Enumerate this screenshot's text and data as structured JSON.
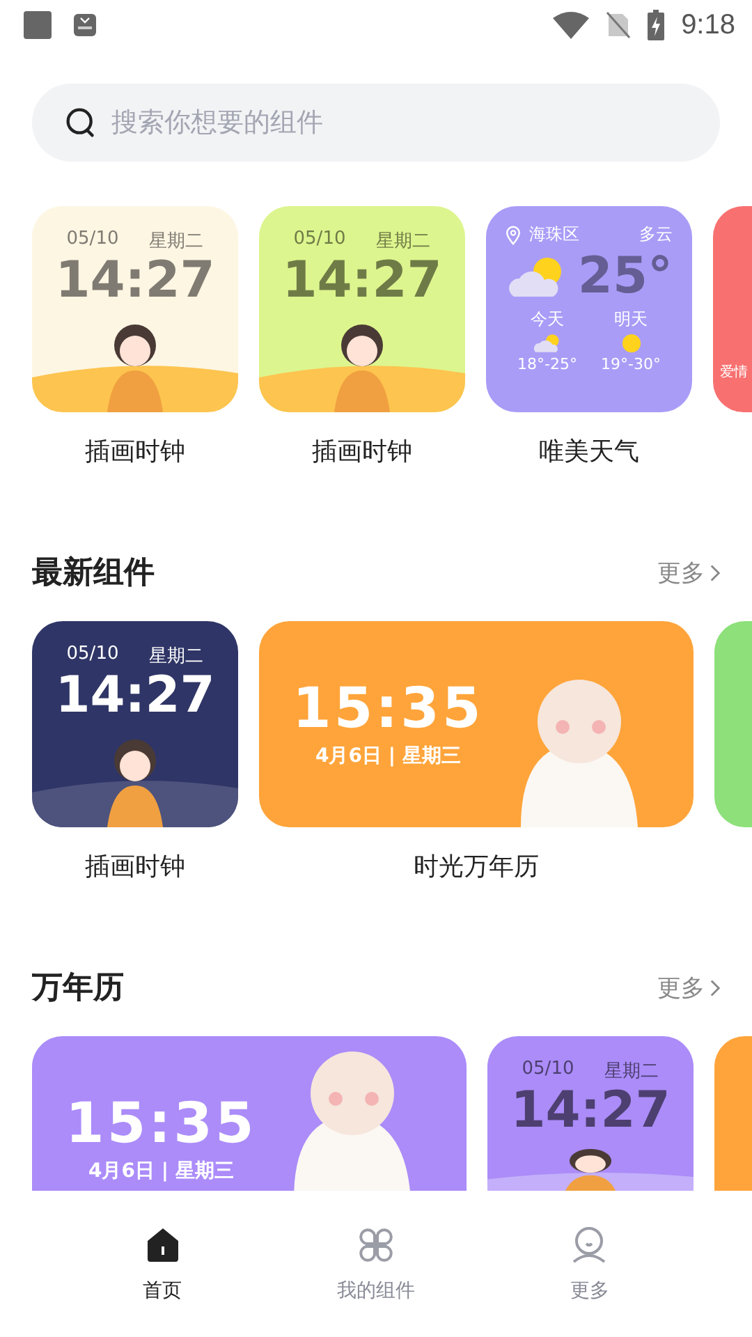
{
  "status_bar": {
    "time": "9:18"
  },
  "search": {
    "placeholder": "搜索你想要的组件"
  },
  "featured": [
    {
      "kind": "clock",
      "color": "#fdf6e3",
      "date": "05/10",
      "weekday": "星期二",
      "time": "14:27",
      "label": "插画时钟"
    },
    {
      "kind": "clock",
      "color": "#ddf58e",
      "date": "05/10",
      "weekday": "星期二",
      "time": "14:27",
      "label": "插画时钟"
    },
    {
      "kind": "weather",
      "color": "#a99cf7",
      "place": "海珠区",
      "condition": "多云",
      "temp": "25°",
      "days": [
        {
          "name": "今天",
          "range": "18°-25°"
        },
        {
          "name": "明天",
          "range": "19°-30°"
        }
      ],
      "label": "唯美天气"
    },
    {
      "kind": "peek",
      "color": "#f87070",
      "text": "爱情"
    }
  ],
  "sections": [
    {
      "title": "最新组件",
      "more": "更多",
      "cards": [
        {
          "kind": "clock",
          "color": "#2f3566",
          "date": "05/10",
          "weekday": "星期二",
          "time": "14:27",
          "label": "插画时钟"
        },
        {
          "kind": "calendar",
          "color": "#ffa43a",
          "time": "15:35",
          "date": "4月6日 | 星期三",
          "label": "时光万年历"
        },
        {
          "kind": "peek",
          "color": "#8de07a"
        }
      ]
    },
    {
      "title": "万年历",
      "more": "更多",
      "cards": [
        {
          "kind": "calendar",
          "color": "#ab8cf9",
          "time": "15:35",
          "date": "4月6日 | 星期三"
        },
        {
          "kind": "clock",
          "color": "#ab8cf8",
          "date": "05/10",
          "weekday": "星期二",
          "time": "14:27"
        },
        {
          "kind": "peek",
          "color": "#ffa43b"
        }
      ]
    }
  ],
  "bottom_nav": [
    {
      "label": "首页",
      "selected": true
    },
    {
      "label": "我的组件",
      "selected": false
    },
    {
      "label": "更多",
      "selected": false
    }
  ]
}
